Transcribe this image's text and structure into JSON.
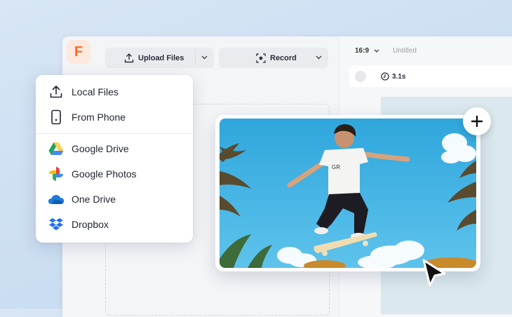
{
  "toolbar": {
    "upload_label": "Upload Files",
    "record_label": "Record",
    "aspect_ratio": "16:9",
    "project_title": "Untitled",
    "duration": "3.1s"
  },
  "upload_menu": {
    "items": [
      {
        "label": "Local Files",
        "icon": "upload-icon"
      },
      {
        "label": "From Phone",
        "icon": "phone-icon"
      },
      {
        "label": "Google Drive",
        "icon": "google-drive-icon"
      },
      {
        "label": "Google Photos",
        "icon": "google-photos-icon"
      },
      {
        "label": "One Drive",
        "icon": "onedrive-icon"
      },
      {
        "label": "Dropbox",
        "icon": "dropbox-icon"
      }
    ]
  },
  "colors": {
    "brand": "#ff6a2b",
    "sky": "#3fb0e3",
    "drive_green": "#1fa463",
    "drive_yellow": "#ffd04b",
    "drive_blue": "#4688f4",
    "onedrive_blue": "#1e7ad6",
    "dropbox_blue": "#1f6ff2"
  },
  "brand_logo": "F",
  "preview": {
    "image": "skateboarder-jump-photo"
  }
}
